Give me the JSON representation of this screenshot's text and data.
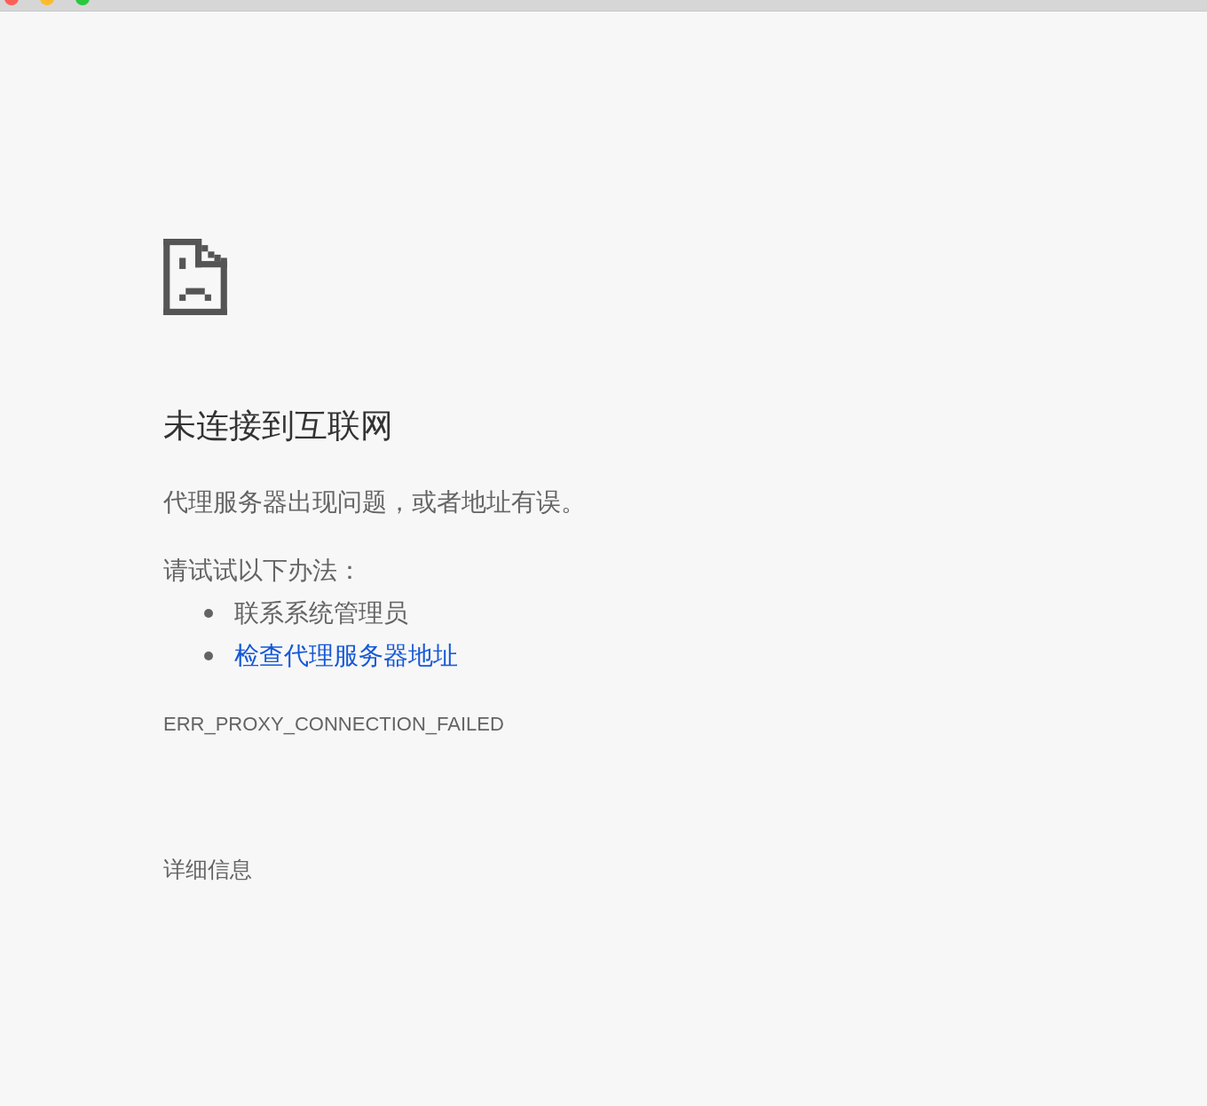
{
  "error": {
    "heading": "未连接到互联网",
    "description": "代理服务器出现问题，或者地址有误。",
    "suggestions_label": "请试试以下办法：",
    "suggestions": [
      {
        "kind": "text",
        "text": "联系系统管理员"
      },
      {
        "kind": "link",
        "text": "检查代理服务器地址"
      }
    ],
    "code": "ERR_PROXY_CONNECTION_FAILED",
    "details_button": "详细信息"
  }
}
